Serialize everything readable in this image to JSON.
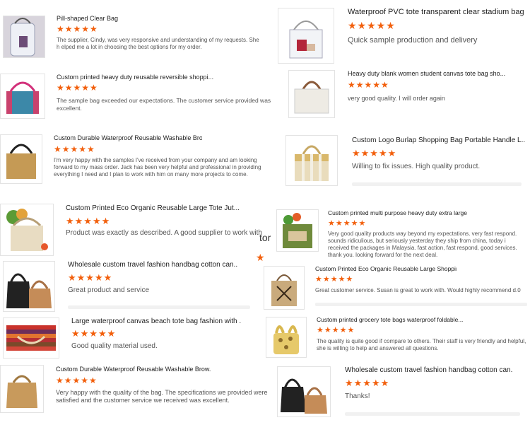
{
  "reviews": [
    {
      "title": "Pill-shaped Clear Bag",
      "stars": "★★★★★",
      "review": "The supplier, Cindy, was very responsive and understanding of my requests. She h elped me a lot in choosing the best options for my order."
    },
    {
      "title": "Waterproof PVC tote transparent clear stadium bag",
      "stars": "★★★★★",
      "review": "Quick sample production and delivery"
    },
    {
      "title": "Custom printed heavy duty reusable reversible shoppi...",
      "stars": "★★★★★",
      "review": "The sample bag exceeded our expectations. The customer service provided was excellent."
    },
    {
      "title": "Heavy duty blank women student canvas tote bag sho...",
      "stars": "★★★★★",
      "review": "very good quality. I will order again"
    },
    {
      "title": "Custom Durable Waterproof Reusable Washable Brow...",
      "stars": "★★★★★",
      "review": "I'm very happy with the samples I've received from your company and am looking forward to my mass order. Jack has been very helpful and professional in providing everything I need and I plan to work with him on many more projects to come."
    },
    {
      "title": "Custom Logo Burlap Shopping Bag Portable Handle L...",
      "stars": "★★★★★",
      "review": "Willing to fix issues. High quality product."
    },
    {
      "title": "Custom Printed Eco Organic Reusable Large Tote Jut...",
      "stars": "★★★★★",
      "review": "Product was exactly as described.  A good supplier to work with"
    },
    {
      "title": "Custom printed multi purpose heavy duty extra large ...",
      "stars": "★★★★★",
      "review": "Very good quality products way beyond my expectations. very fast respond. sounds ridiculious, but seriously yesterday they ship from china, today i received the packages in Malaysia. fast action, fast respond, good services. thank you. looking forward for the next deal."
    },
    {
      "title": "Wholesale custom travel fashion handbag cotton can...",
      "stars": "★★★★★",
      "review": "Great product and service"
    },
    {
      "title": "Custom Printed Eco Organic Reusable Large Shoppin...",
      "stars": "★★★★★",
      "review": "Great customer service. Susan is great to work with. Would highly recommend d.0"
    },
    {
      "title": "Large waterproof canvas beach tote bag fashion with .",
      "stars": "★★★★★",
      "review": "Good quality material used."
    },
    {
      "title": "Custom printed grocery tote bags waterproof foldable...",
      "stars": "★★★★★",
      "review": "The quality is quite good if compare to others. Their staff is very friendly and helpful, she is willing to help and answered all questions."
    },
    {
      "title": "Custom Durable Waterproof Reusable Washable Brow...",
      "stars": "★★★★★",
      "review": "Very happy with the quality of the bag.  The specifications we provided were satisfied and the customer service we received was excellent."
    },
    {
      "title": "Wholesale custom travel fashion handbag cotton can.",
      "stars": "★★★★★",
      "review": "Thanks!"
    }
  ],
  "stray": {
    "text": "tor",
    "star": "★"
  },
  "colors": {
    "star": "#f25f0c",
    "title": "#222222",
    "review": "#555555",
    "border": "#e3e3e3"
  }
}
